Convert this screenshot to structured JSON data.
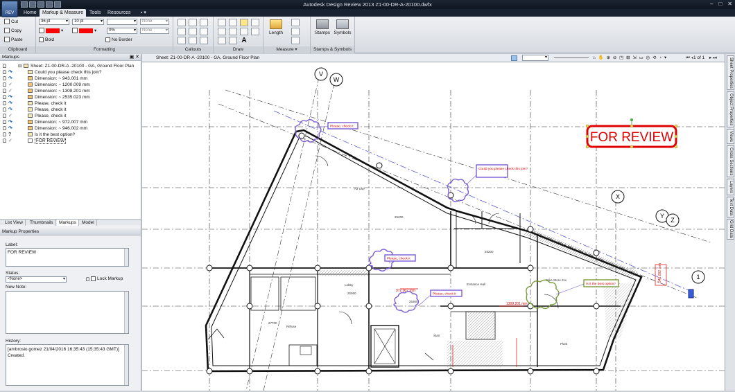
{
  "titlebar": {
    "app_button": "REV",
    "title": "Autodesk Design Review 2013    Z1-00-DR-A-20100.dwfx",
    "minimize_glyph": "–",
    "maximize_glyph": "□",
    "close_glyph": "✕"
  },
  "menu_tabs": [
    "Home",
    "Markup & Measure",
    "Tools",
    "Resources",
    "▪ ▾"
  ],
  "ribbon": {
    "clipboard": {
      "cut": "Cut",
      "copy": "Copy",
      "paste": "Paste",
      "label": "Clipboard"
    },
    "formatting": {
      "font_size": "36 pt",
      "line_weight": "10 pt",
      "fill_none": "None",
      "line_none": "None",
      "transparency": "0%",
      "bold": "Bold",
      "no_border": "No Border",
      "label": "Formatting",
      "accent_color": "#ff0000"
    },
    "callouts_label": "Callouts",
    "draw_label": "Draw",
    "measure": {
      "length": "Length",
      "label": "Measure ▾"
    },
    "stamps": {
      "stamps": "Stamps",
      "symbols": "Symbols",
      "label": "Stamps & Symbols"
    }
  },
  "markups_panel": {
    "title": "Markups",
    "items": [
      {
        "text": "Sheet: Z1-00-DR-A -20100 - GA, Ground Floor Plan",
        "status": "",
        "icon": "sheet-icon",
        "level": 0
      },
      {
        "text": "Could you please check this join?",
        "status": "↷",
        "icon": "note-icon",
        "level": 1
      },
      {
        "text": "Dimension: ~ 943.001 mm",
        "status": "↷",
        "icon": "dimension-icon",
        "level": 1
      },
      {
        "text": "Dimension: ~ 1200.009 mm",
        "status": "✓",
        "icon": "dimension-icon",
        "level": 1
      },
      {
        "text": "Dimension: ~ 1308.201 mm",
        "status": "✓",
        "icon": "dimension-icon",
        "level": 1
      },
      {
        "text": "Dimension: ~ 2535.023 mm",
        "status": "↷",
        "icon": "dimension-icon",
        "level": 1
      },
      {
        "text": "Please, check it",
        "status": "↷",
        "icon": "note-icon",
        "level": 1
      },
      {
        "text": "Please, check it",
        "status": "↷",
        "icon": "note-icon",
        "level": 1
      },
      {
        "text": "Please, check it",
        "status": "✓",
        "icon": "note-icon",
        "level": 1
      },
      {
        "text": "Dimension: ~ 972.007 mm",
        "status": "↷",
        "icon": "dimension-icon",
        "level": 1
      },
      {
        "text": "Dimension: ~ 946.002 mm",
        "status": "↷",
        "icon": "dimension-icon",
        "level": 1
      },
      {
        "text": "Is it the best option?",
        "status": "?",
        "icon": "note-icon",
        "level": 1
      },
      {
        "text": "FOR REVIEW",
        "status": "✓",
        "icon": "stamp-icon",
        "level": 1
      }
    ]
  },
  "panel_tabs": [
    "List View",
    "Thumbnails",
    "Markups",
    "Model"
  ],
  "markup_properties": {
    "title": "Markup Properties",
    "label_caption": "Label:",
    "label_value": "FOR REVIEW",
    "status_caption": "Status:",
    "status_value": "<None>",
    "lock_markup": "Lock Markup",
    "new_note_caption": "New Note:",
    "history_caption": "History:",
    "history_line1": "[ambrosio.gomez  21/04/2016  16:35:43  (15:35:43 GMT)]",
    "history_line2": "Created."
  },
  "viewer": {
    "sheet_title": "Sheet: Z1-00-DR-A -20100 - GA, Ground Floor Plan",
    "page_indicator": "1 of 1"
  },
  "drawing": {
    "stamp_text": "FOR REVIEW",
    "stamp_color": "#e00000",
    "cloud_color": "#7b5cd6",
    "green_cloud_color": "#7a9a3a",
    "grid_labels": [
      "V",
      "W",
      "X",
      "Y",
      "Z",
      "1"
    ],
    "callouts": [
      "Please, check it",
      "Could you please check this join?",
      "Please, check it",
      "Please, check it",
      "Is it the best option?"
    ],
    "dimensions": [
      "972.007 mm",
      "1308.201 mm",
      "946.002 mm"
    ],
    "rooms": [
      "A2 Use",
      "Entrance Hall",
      "Lobby",
      "Refuse",
      "Bike Store 2xx",
      "Stair",
      "Plant"
    ],
    "room_numbers": [
      "25200",
      "25200",
      "25050",
      "27700",
      "25300"
    ]
  },
  "right_tabs": [
    "Sheet Properties",
    "Object Properties",
    "Views",
    "Cross Sections",
    "Layers",
    "Text Data",
    "Grid Data"
  ]
}
